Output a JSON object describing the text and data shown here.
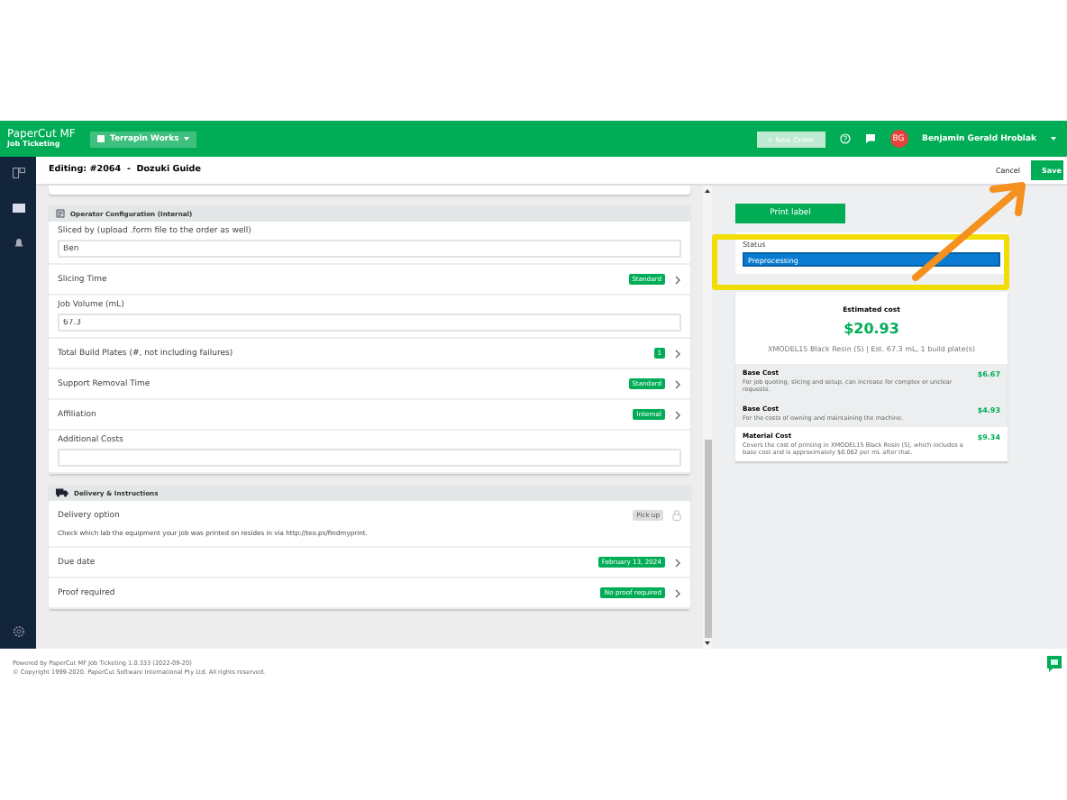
{
  "header": {
    "logo_title": "PaperCut MF",
    "logo_subtitle": "Job Ticketing",
    "workspace": "Terrapin Works",
    "new_order": "+ New Order",
    "avatar_initials": "BG",
    "user_name": "Benjamin Gerald Hroblak"
  },
  "edit_bar": {
    "title": "Editing: #2064  -  Dozuki Guide",
    "cancel": "Cancel",
    "save": "Save"
  },
  "operator_section": {
    "title": "Operator Configuration (Internal)",
    "rows": [
      {
        "kind": "input",
        "label": "Sliced by (upload .form file to the order as well)",
        "value": "Ben"
      },
      {
        "kind": "option",
        "label": "Slicing Time",
        "badge": "Standard"
      },
      {
        "kind": "input",
        "label": "Job Volume (mL)",
        "value": "67.3"
      },
      {
        "kind": "option",
        "label": "Total Build Plates (#, not including failures)",
        "badge": "1"
      },
      {
        "kind": "option",
        "label": "Support Removal Time",
        "badge": "Standard"
      },
      {
        "kind": "option",
        "label": "Affiliation",
        "badge": "Internal"
      },
      {
        "kind": "input",
        "label": "Additional Costs"
      }
    ]
  },
  "delivery_section": {
    "title": "Delivery & Instructions",
    "rows": [
      {
        "kind": "locked",
        "label": "Delivery option",
        "badge": "Pick up",
        "note": "Check which lab the equipment your job was printed on resides in via http://teo.ps/findmyprint."
      },
      {
        "kind": "option",
        "label": "Due date",
        "badge": "February 13, 2024"
      },
      {
        "kind": "option",
        "label": "Proof required",
        "badge": "No proof required"
      }
    ]
  },
  "side": {
    "print_label": "Print label",
    "status": {
      "label": "Status",
      "value": "Preprocessing"
    },
    "cost": {
      "title": "Estimated cost",
      "total": "$20.93",
      "detail": "XMODEL15 Black Resin (S) | Est. 67.3 mL, 1 build plate(s)",
      "items": [
        {
          "name": "Base Cost",
          "description": "For job quoting, slicing and setup, can increase for complex or unclear requests.",
          "amount": "$6.67",
          "shaded": true
        },
        {
          "name": "Base Cost",
          "description": "For the costs of owning and maintaining the machine.",
          "amount": "$4.93",
          "shaded": true
        },
        {
          "name": "Material Cost",
          "description": "Covers the cost of printing in XMODEL15 Black Resin (S), which includes a base cost and is approximately $0.062 per mL after that.",
          "amount": "$9.34",
          "shaded": false
        }
      ]
    }
  },
  "footer": [
    "Powered by PaperCut MF Job Ticketing 1.0.333 (2022-09-20)",
    "© Copyright 1999-2020. PaperCut Software International Pty Ltd. All rights reserved."
  ]
}
